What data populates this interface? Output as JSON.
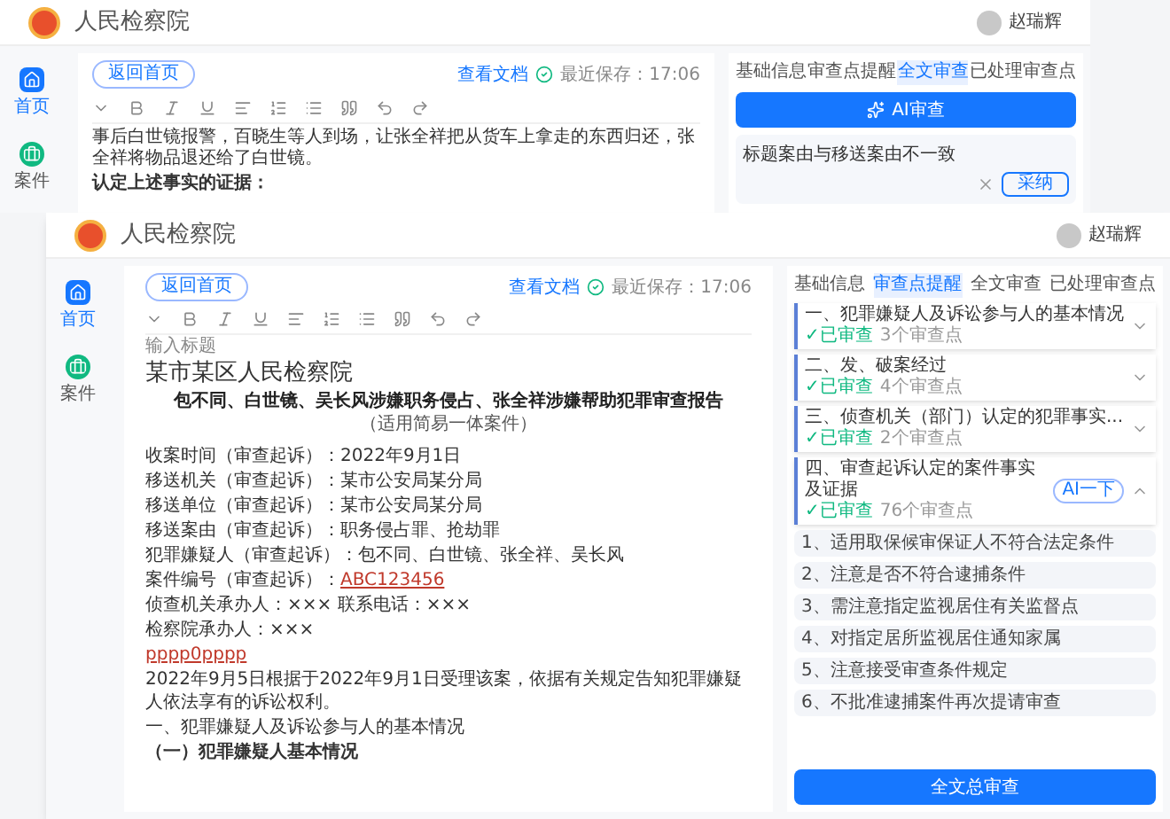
{
  "back_window": {
    "org_name": "人民检察院",
    "user_name": "赵瑞辉",
    "nav": [
      {
        "label": "首页",
        "selected": true
      },
      {
        "label": "案件",
        "selected": false
      }
    ],
    "back_button": "返回首页",
    "doc_link": "查看文档",
    "save_time": "最近保存：17:06",
    "paragraphs": [
      {
        "kind": "text",
        "text": "事后白世镜报警，百晓生等人到场，让张全祥把从货车上拿走的东西归还，张全祥将物品退还给了白世镜。"
      },
      {
        "kind": "bold",
        "text": "认定上述事实的证据："
      }
    ],
    "tabs": [
      {
        "label": "基础信息",
        "selected": false
      },
      {
        "label": "审查点提醒",
        "selected": false
      },
      {
        "label": "全文审查",
        "selected": true
      },
      {
        "label": "已处理审查点",
        "selected": false
      }
    ],
    "ai_button": "AI审查",
    "suggestion": {
      "text": "标题案由与移送案由不一致",
      "accept_button": "采纳"
    }
  },
  "front_window": {
    "org_name": "人民检察院",
    "user_name": "赵瑞辉",
    "nav": [
      {
        "label": "首页",
        "selected": true
      },
      {
        "label": "案件",
        "selected": false
      }
    ],
    "back_button": "返回首页",
    "doc_link": "查看文档",
    "save_time": "最近保存：17:06",
    "title_placeholder": "输入标题",
    "doc_org": "某市某区人民检察院",
    "doc_heading": "包不同、白世镜、吴长风涉嫌职务侵占、张全祥涉嫌帮助犯罪审查报告",
    "doc_subheading": "（适用简易一体案件）",
    "fields": [
      {
        "label": "收案时间（审查起诉）：",
        "value": "2022年9月1日"
      },
      {
        "label": "移送机关（审查起诉）：",
        "value": "某市公安局某分局"
      },
      {
        "label": "移送单位（审查起诉）：",
        "value": "某市公安局某分局"
      },
      {
        "label": "移送案由（审查起诉）：",
        "value": "职务侵占罪、抢劫罪"
      },
      {
        "label": "犯罪嫌疑人（审查起诉）：",
        "value": "包不同、白世镜、张全祥、吴长风"
      },
      {
        "label": "案件编号（审查起诉）：",
        "value": "ABC123456",
        "link": true
      },
      {
        "label": "侦查机关承办人：",
        "value": "××× 联系电话：×××"
      },
      {
        "label": "检察院承办人：",
        "value": "×××"
      }
    ],
    "marked_code": "pppp0pppp",
    "body": [
      {
        "kind": "text",
        "text": "2022年9月5日根据于2022年9月1日受理该案，依据有关规定告知犯罪嫌疑人依法享有的诉讼权利。"
      },
      {
        "kind": "text",
        "text": "一、犯罪嫌疑人及诉讼参与人的基本情况"
      },
      {
        "kind": "bold",
        "text": "（一）犯罪嫌疑人基本情况"
      }
    ],
    "tabs": [
      {
        "label": "基础信息",
        "selected": false
      },
      {
        "label": "审查点提醒",
        "selected": true
      },
      {
        "label": "全文审查",
        "selected": false
      },
      {
        "label": "已处理审查点",
        "selected": false
      }
    ],
    "sections": [
      {
        "title": "一、犯罪嫌疑人及诉讼参与人的基本情况",
        "status": "✓已审查",
        "count": "3个审查点",
        "expanded": false
      },
      {
        "title": "二、发、破案经过",
        "status": "✓已审查",
        "count": "4个审查点",
        "expanded": false
      },
      {
        "title": "三、侦查机关（部门）认定的犯罪事实...",
        "status": "✓已审查",
        "count": "2个审查点",
        "expanded": false
      },
      {
        "title": "四、审查起诉认定的案件事实及证据",
        "status": "✓已审查",
        "count": "76个审查点",
        "badge": "AI一下",
        "expanded": true
      }
    ],
    "points": [
      "1、适用取保候审保证人不符合法定条件",
      "2、注意是否不符合逮捕条件",
      "3、需注意指定监视居住有关监督点",
      "4、对指定居所监视居住通知家属",
      "5、注意接受审查条件规定",
      "6、不批准逮捕案件再次提请审查"
    ],
    "bottom_button": "全文总审查"
  }
}
